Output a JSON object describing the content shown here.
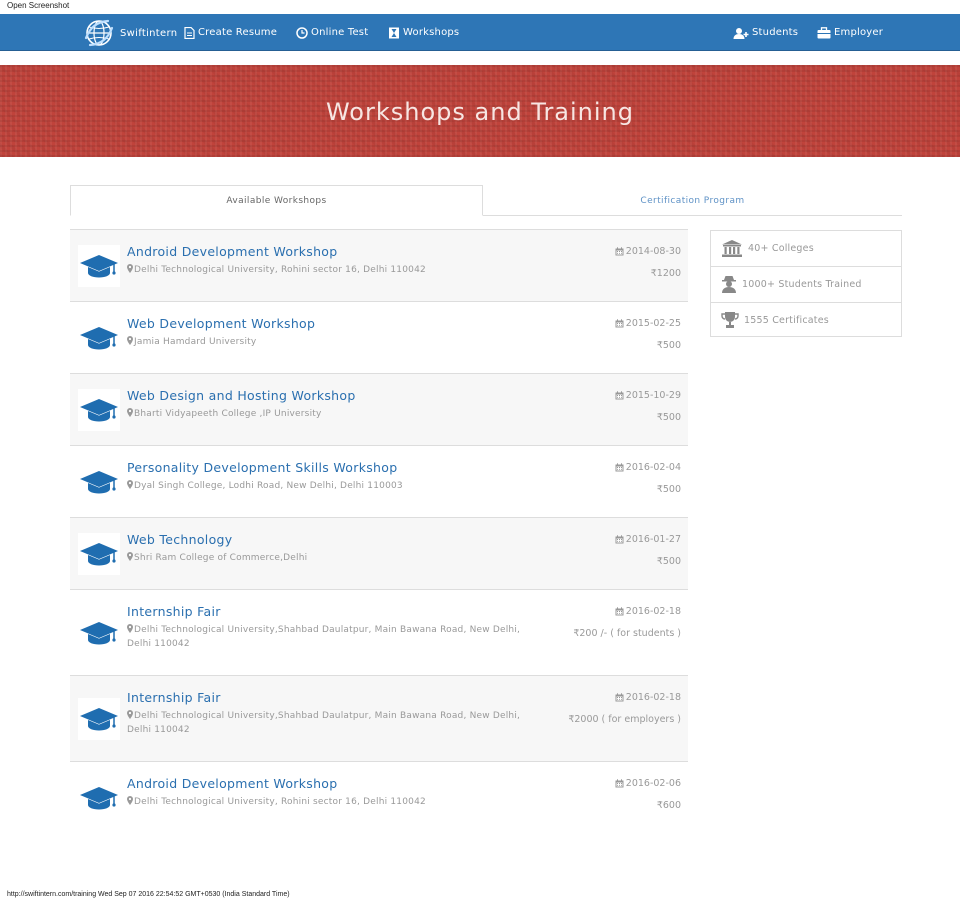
{
  "window": {
    "caption": "Open Screenshot"
  },
  "nav": {
    "brand": "Swiftintern",
    "left_items": [
      {
        "label": "Create Resume",
        "icon": "document-icon"
      },
      {
        "label": "Online Test",
        "icon": "clock-icon"
      },
      {
        "label": "Workshops",
        "icon": "hourglass-icon"
      }
    ],
    "right_items": [
      {
        "label": "Students",
        "icon": "user-plus-icon"
      },
      {
        "label": "Employer",
        "icon": "briefcase-icon"
      }
    ]
  },
  "hero": {
    "title": "Workshops and Training"
  },
  "tabs": [
    {
      "label": "Available Workshops",
      "active": true
    },
    {
      "label": "Certification Program",
      "active": false
    }
  ],
  "workshops": [
    {
      "title": "Android Development Workshop",
      "location": "Delhi Technological University, Rohini sector 16, Delhi 110042",
      "date": "2014-08-30",
      "price": "₹1200"
    },
    {
      "title": "Web Development Workshop",
      "location": "Jamia Hamdard University",
      "date": "2015-02-25",
      "price": "₹500"
    },
    {
      "title": "Web Design and Hosting Workshop",
      "location": "Bharti Vidyapeeth College ,IP University",
      "date": "2015-10-29",
      "price": "₹500"
    },
    {
      "title": "Personality Development Skills Workshop",
      "location": "Dyal Singh College, Lodhi Road, New Delhi, Delhi 110003",
      "date": "2016-02-04",
      "price": "₹500"
    },
    {
      "title": "Web Technology",
      "location": "Shri Ram College of Commerce,Delhi",
      "date": "2016-01-27",
      "price": "₹500"
    },
    {
      "title": "Internship Fair",
      "location": "Delhi Technological University,Shahbad Daulatpur, Main Bawana Road, New Delhi, Delhi 110042",
      "date": "2016-02-18",
      "price": "₹200 /- ( for students )"
    },
    {
      "title": "Internship Fair",
      "location": "Delhi Technological University,Shahbad Daulatpur, Main Bawana Road, New Delhi, Delhi 110042",
      "date": "2016-02-18",
      "price": "₹2000 ( for employers )"
    },
    {
      "title": "Android Development Workshop",
      "location": "Delhi Technological University, Rohini sector 16, Delhi 110042",
      "date": "2016-02-06",
      "price": "₹600"
    }
  ],
  "stats": [
    {
      "label": "40+ Colleges",
      "icon": "institution-icon"
    },
    {
      "label": "1000+ Students Trained",
      "icon": "user-secret-icon"
    },
    {
      "label": "1555 Certificates",
      "icon": "trophy-icon"
    }
  ],
  "status_bar": {
    "text": "http://swiftintern.com/training Wed Sep 07 2016 22:54:52 GMT+0530 (India Standard Time)"
  },
  "colors": {
    "nav": "#2e76b6",
    "hero": "#c0433b",
    "link": "#2a6faf"
  }
}
